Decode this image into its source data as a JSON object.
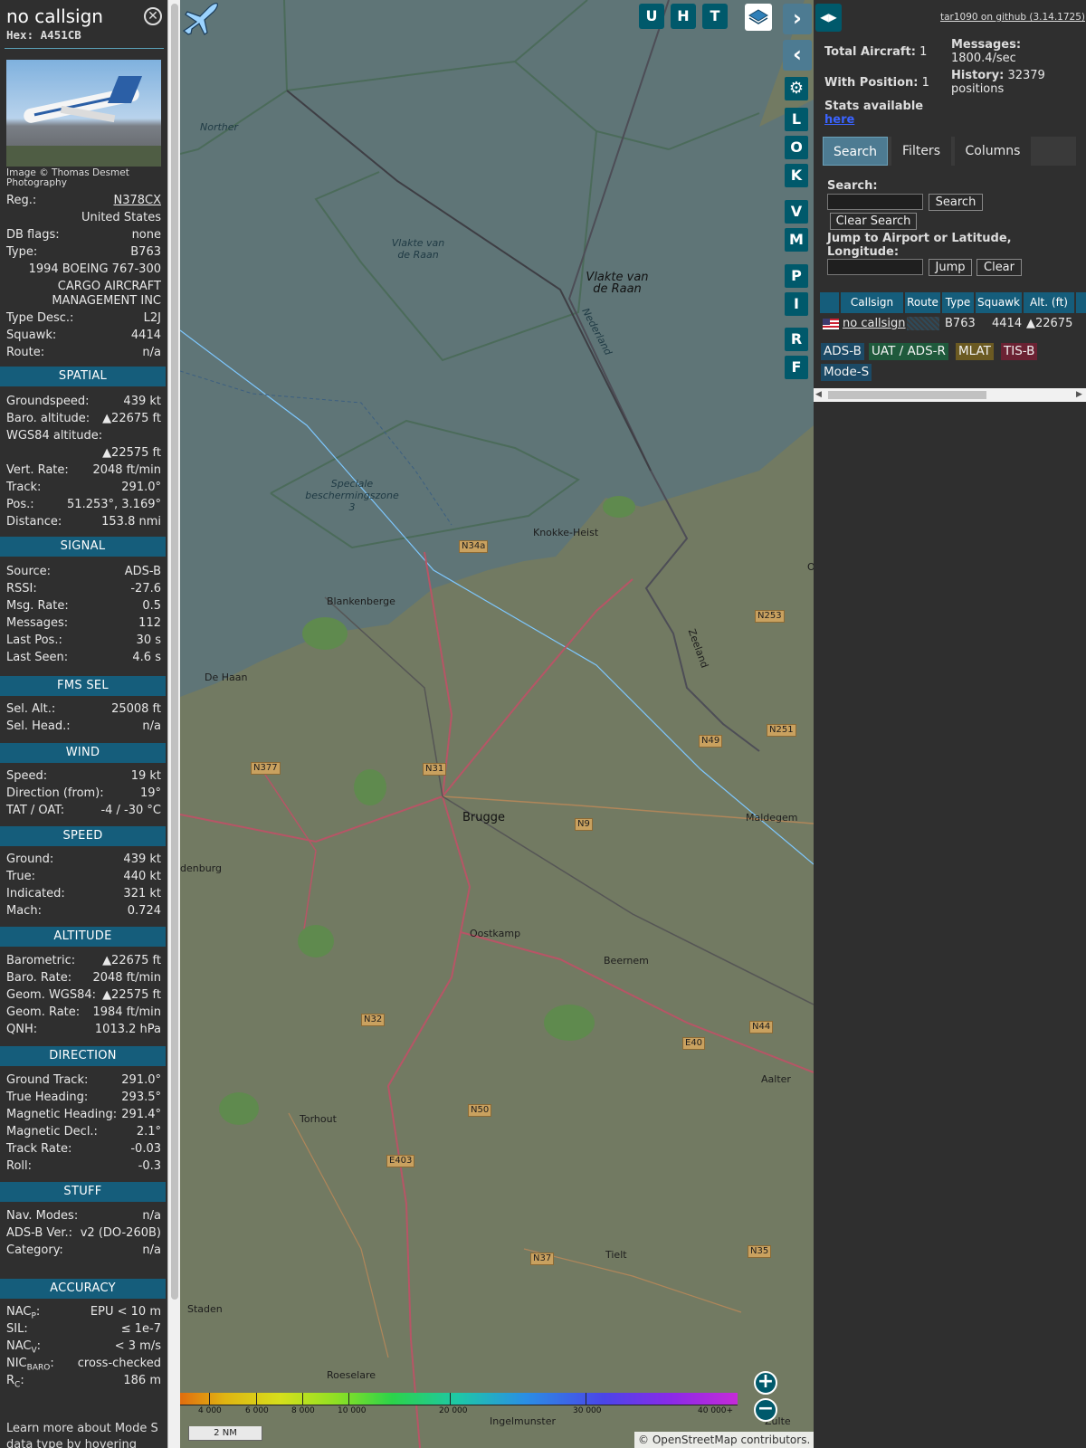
{
  "info": {
    "callsign": "no callsign",
    "hex_label": "Hex:",
    "hex": "A451CB",
    "close_icon": "close-icon",
    "photo_credit": "Image © Thomas Desmet Photography",
    "basic": [
      {
        "k": "Reg.:",
        "v": "N378CX",
        "link": true
      },
      {
        "k": "",
        "v": "United States"
      },
      {
        "k": "DB flags:",
        "v": "none"
      },
      {
        "k": "Type:",
        "v": "B763"
      },
      {
        "k": "",
        "v": "1994 BOEING 767-300"
      },
      {
        "k": "",
        "v": "CARGO AIRCRAFT MANAGEMENT INC"
      },
      {
        "k": "Type Desc.:",
        "v": "L2J"
      },
      {
        "k": "Squawk:",
        "v": "4414"
      },
      {
        "k": "Route:",
        "v": "n/a"
      }
    ],
    "sections": {
      "spatial": "SPATIAL",
      "signal": "SIGNAL",
      "fms": "FMS SEL",
      "wind": "WIND",
      "speed": "SPEED",
      "altitude": "ALTITUDE",
      "direction": "DIRECTION",
      "stuff": "STUFF",
      "accuracy": "ACCURACY"
    },
    "spatial": [
      {
        "k": "Groundspeed:",
        "v": "439 kt"
      },
      {
        "k": "Baro. altitude:",
        "v": "▲22675 ft"
      },
      {
        "k": "WGS84 altitude:",
        "v": ""
      },
      {
        "k": "",
        "v": "▲22575 ft"
      },
      {
        "k": "Vert. Rate:",
        "v": "2048 ft/min"
      },
      {
        "k": "Track:",
        "v": "291.0°"
      },
      {
        "k": "Pos.:",
        "v": "51.253°, 3.169°"
      },
      {
        "k": "Distance:",
        "v": "153.8 nmi"
      }
    ],
    "signal": [
      {
        "k": "Source:",
        "v": "ADS-B"
      },
      {
        "k": "RSSI:",
        "v": "-27.6"
      },
      {
        "k": "Msg. Rate:",
        "v": "0.5"
      },
      {
        "k": "Messages:",
        "v": "112"
      },
      {
        "k": "Last Pos.:",
        "v": "30 s"
      },
      {
        "k": "Last Seen:",
        "v": "4.6 s"
      }
    ],
    "fms": [
      {
        "k": "Sel. Alt.:",
        "v": "25008 ft"
      },
      {
        "k": "Sel. Head.:",
        "v": "n/a"
      }
    ],
    "wind": [
      {
        "k": "Speed:",
        "v": "19 kt"
      },
      {
        "k": "Direction (from):",
        "v": "19°"
      },
      {
        "k": "TAT / OAT:",
        "v": "-4 / -30 °C"
      }
    ],
    "speed": [
      {
        "k": "Ground:",
        "v": "439 kt"
      },
      {
        "k": "True:",
        "v": "440 kt"
      },
      {
        "k": "Indicated:",
        "v": "321 kt"
      },
      {
        "k": "Mach:",
        "v": "0.724"
      }
    ],
    "altitude": [
      {
        "k": "Barometric:",
        "v": "▲22675 ft"
      },
      {
        "k": "Baro. Rate:",
        "v": "2048 ft/min"
      },
      {
        "k": "Geom. WGS84:",
        "v": "▲22575 ft"
      },
      {
        "k": "Geom. Rate:",
        "v": "1984 ft/min"
      },
      {
        "k": "QNH:",
        "v": "1013.2 hPa"
      }
    ],
    "direction": [
      {
        "k": "Ground Track:",
        "v": "291.0°"
      },
      {
        "k": "True Heading:",
        "v": "293.5°"
      },
      {
        "k": "Magnetic Heading:",
        "v": "291.4°"
      },
      {
        "k": "Magnetic Decl.:",
        "v": "2.1°"
      },
      {
        "k": "Track Rate:",
        "v": "-0.03"
      },
      {
        "k": "Roll:",
        "v": "-0.3"
      }
    ],
    "stuff": [
      {
        "k": "Nav. Modes:",
        "v": "n/a"
      },
      {
        "k": "ADS-B Ver.:",
        "v": "v2 (DO-260B)"
      },
      {
        "k": "Category:",
        "v": "n/a"
      }
    ],
    "accuracy": [
      {
        "k": "NAC",
        "sub": "P",
        "v": "EPU < 10 m"
      },
      {
        "k": "SIL:",
        "sub": "",
        "v": "≤ 1e-7"
      },
      {
        "k": "NAC",
        "sub": "V",
        "v": "< 3 m/s"
      },
      {
        "k": "NIC",
        "sub": "BARO",
        "v": "cross-checked"
      },
      {
        "k": "R",
        "sub": "C",
        "v": "186 m"
      }
    ],
    "learn_more": "Learn more about Mode S data type by hovering over"
  },
  "map": {
    "toolbar": [
      "U",
      "H",
      "T"
    ],
    "side_buttons": [
      "L",
      "O",
      "K",
      "V",
      "M",
      "P",
      "I",
      "R",
      "F"
    ],
    "labels": {
      "northern": "Norther",
      "vlakte1": "Vlakte van de Raan",
      "vlakte2": "Vlakte van de Raan",
      "nederland": "Nederland",
      "speciale": "Speciale beschermingszone 3",
      "knokke": "Knokke-Heist",
      "blankenberge": "Blankenberge",
      "dehaan": "De Haan",
      "brugge": "Brugge",
      "maldegem": "Maldegem",
      "oostkamp": "Oostkamp",
      "beernem": "Beernem",
      "aalter": "Aalter",
      "torhout": "Torhout",
      "tielt": "Tielt",
      "staden": "Staden",
      "roeselare": "Roeselare",
      "ingelmunster": "Ingelmunster",
      "zeeland": "Zeeland",
      "denburg": "denburg",
      "zulte": "Zulte",
      "o": "O"
    },
    "roads": [
      "N34a",
      "N253",
      "N49",
      "N251",
      "N377",
      "N31",
      "N9",
      "N32",
      "E40",
      "N44",
      "N50",
      "E403",
      "N37",
      "N35"
    ],
    "colorbar_labels": [
      "4 000",
      "6 000",
      "8 000",
      "10 000",
      "20 000",
      "30 000",
      "40 000+"
    ],
    "scale": "2 NM",
    "attribution_pre": "© ",
    "attribution_link": "OpenStreetMap",
    "attribution_post": " contributors."
  },
  "panel": {
    "github": "tar1090 on github (3.14.1725)",
    "total_aircraft_label": "Total Aircraft:",
    "total_aircraft": "1",
    "with_position_label": "With Position:",
    "with_position": "1",
    "messages_label": "Messages:",
    "messages": "1800.4/sec",
    "history_label": "History:",
    "history": "32379 positions",
    "stats_label": "Stats available",
    "stats_link": "here",
    "tabs": [
      "Search",
      "Filters",
      "Columns"
    ],
    "search_label": "Search:",
    "search_value": "",
    "search_button": "Search",
    "clear_search": "Clear Search",
    "jump_label": "Jump to Airport or Latitude, Longitude:",
    "jump_value": "",
    "jump_button": "Jump",
    "clear_button": "Clear",
    "table": {
      "headers": [
        "",
        "Callsign",
        "Route",
        "Type",
        "Squawk",
        "Alt. (ft)"
      ],
      "row": {
        "callsign": "no callsign",
        "route": "",
        "type": "B763",
        "squawk": "4414",
        "alt": "▲22675"
      }
    },
    "badges": [
      {
        "label": "ADS-B",
        "color": "#1c4a66"
      },
      {
        "label": "UAT / ADS-R",
        "color": "#1f5a3c"
      },
      {
        "label": "MLAT",
        "color": "#6b5a22"
      },
      {
        "label": "TIS-B",
        "color": "#6b2233"
      },
      {
        "label": "Mode-S",
        "color": "#1c4a66"
      }
    ]
  }
}
